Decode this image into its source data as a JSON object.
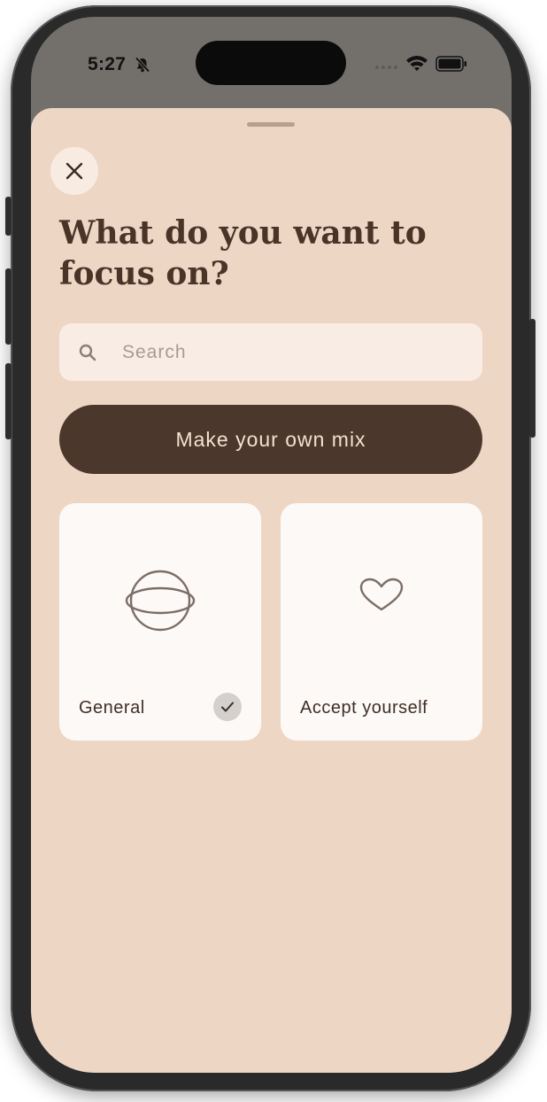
{
  "status_bar": {
    "time": "5:27"
  },
  "sheet": {
    "title": "What do you want to focus on?",
    "close_icon": "close-icon"
  },
  "search": {
    "placeholder": "Search",
    "value": ""
  },
  "mix_button": {
    "label": "Make your own mix"
  },
  "cards": [
    {
      "label": "General",
      "icon": "planet-icon",
      "selected": true
    },
    {
      "label": "Accept yourself",
      "icon": "heart-icon",
      "selected": false
    }
  ],
  "colors": {
    "sheet_background": "#eed6c5",
    "primary_button": "#4b372b",
    "title_text": "#4a3428",
    "card_background": "#fdf9f6"
  }
}
